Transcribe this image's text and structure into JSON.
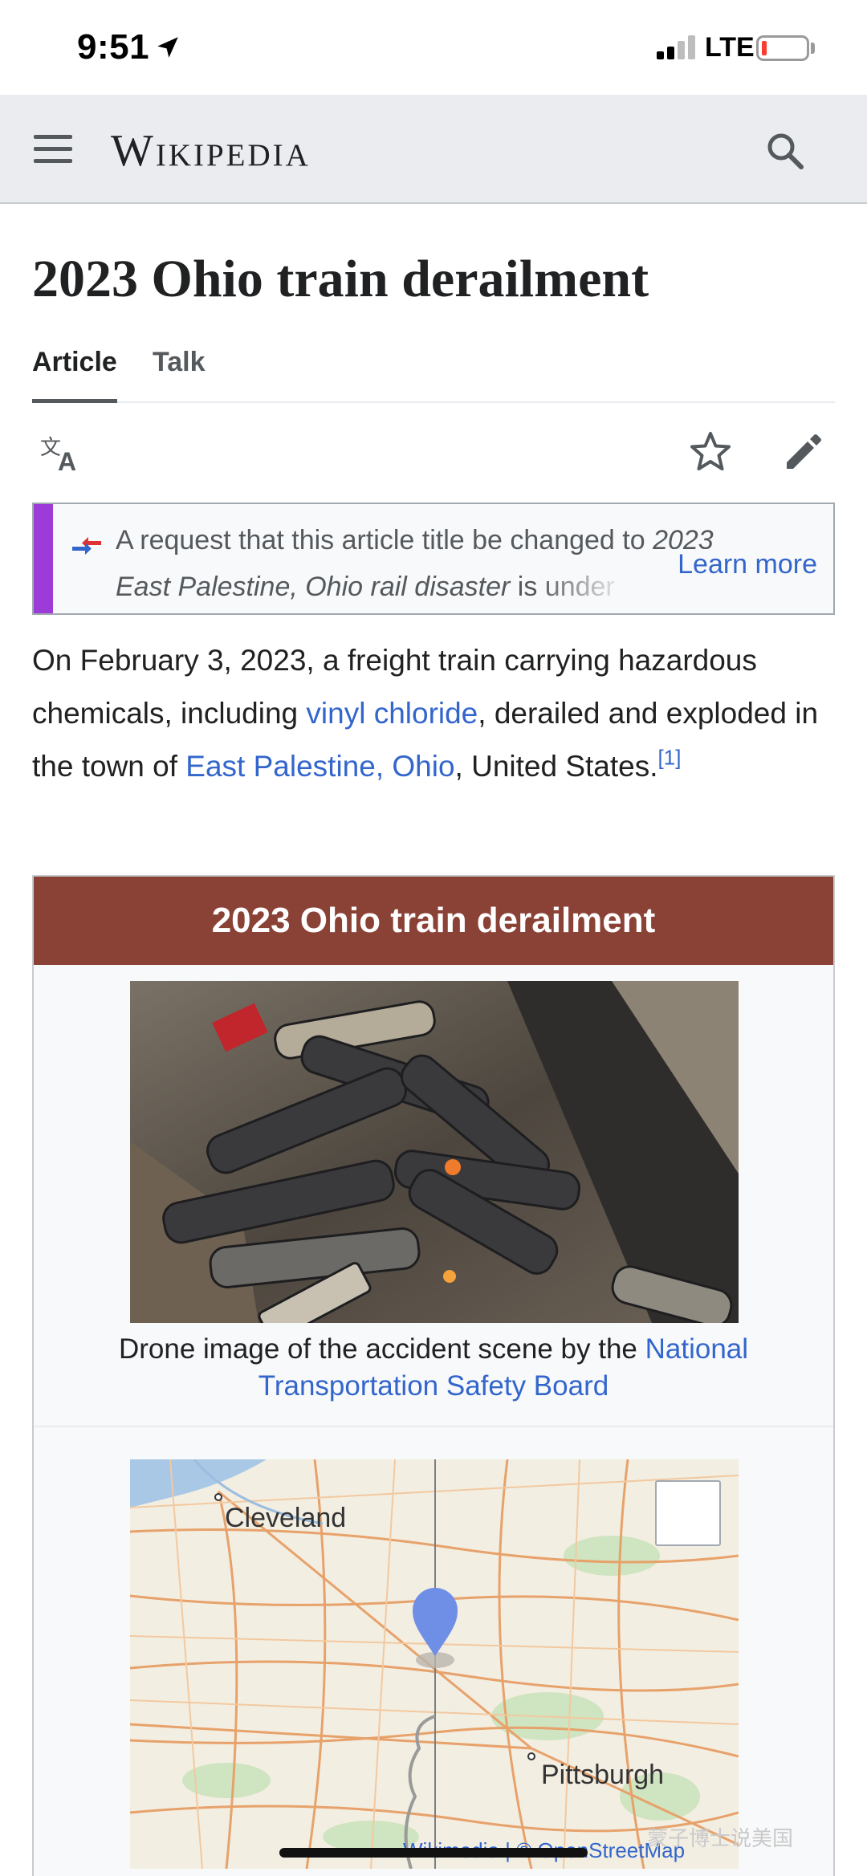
{
  "status_bar": {
    "time": "9:51",
    "network": "LTE",
    "icons": [
      "location-arrow-icon",
      "signal-icon",
      "battery-icon"
    ]
  },
  "header": {
    "wordmark": "Wikipedia",
    "icons": [
      "menu-icon",
      "search-icon"
    ],
    "background": "#eaecf0"
  },
  "page": {
    "title": "2023 Ohio train derailment",
    "tabs": [
      {
        "label": "Article",
        "active": true
      },
      {
        "label": "Talk",
        "active": false
      }
    ],
    "toolbar_icons": [
      "language-icon",
      "watch-star-icon",
      "edit-pencil-icon"
    ]
  },
  "notice": {
    "text_line1_plain": "A request that this article title be changed to ",
    "text_line1_italic": "2023",
    "text_line2_italic": "East Palestine, Ohio rail disaster",
    "text_line2_plain": " is under",
    "learn_more": "Learn more",
    "accent_color": "#9d3bd8"
  },
  "lead": {
    "part1": "On February 3, 2023, a freight train carrying hazardous chemicals, including ",
    "link1": "vinyl chloride",
    "part2": ", derailed and exploded in the town of ",
    "link2": "East Palestine, Ohio",
    "part3": ", United States.",
    "ref": "[1]"
  },
  "infobox": {
    "title": "2023 Ohio train derailment",
    "title_color": "#8b4236",
    "caption_plain": "Drone image of the accident scene by the ",
    "caption_link": "National Transportation Safety Board",
    "map": {
      "labels": [
        "Cleveland",
        "Pittsburgh"
      ],
      "attribution_1": "Wikimedia",
      "attribution_sep": " | © ",
      "attribution_2": "OpenStreetMap"
    }
  },
  "watermark": "蒙子博士说美国",
  "link_color": "#3366cc"
}
